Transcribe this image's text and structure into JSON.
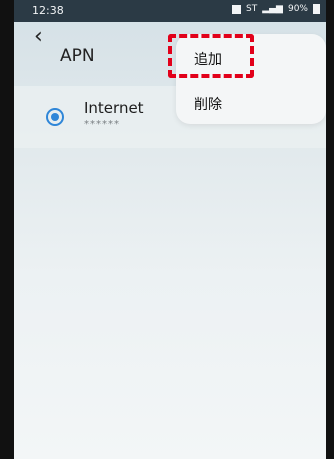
{
  "status_bar": {
    "time": "12:38",
    "network_type": "ST",
    "battery": "90%"
  },
  "header": {
    "back_icon": "chevron-left-icon",
    "title": "APN"
  },
  "overflow_menu": {
    "items": [
      {
        "label": "追加",
        "highlighted": true
      },
      {
        "label": "削除",
        "highlighted": false
      }
    ],
    "highlight_color": "#e2001a"
  },
  "apn_list": [
    {
      "name": "Internet",
      "detail": "******",
      "selected": true
    }
  ],
  "colors": {
    "accent": "#2f86d8",
    "status_bar": "#2b3a45"
  }
}
